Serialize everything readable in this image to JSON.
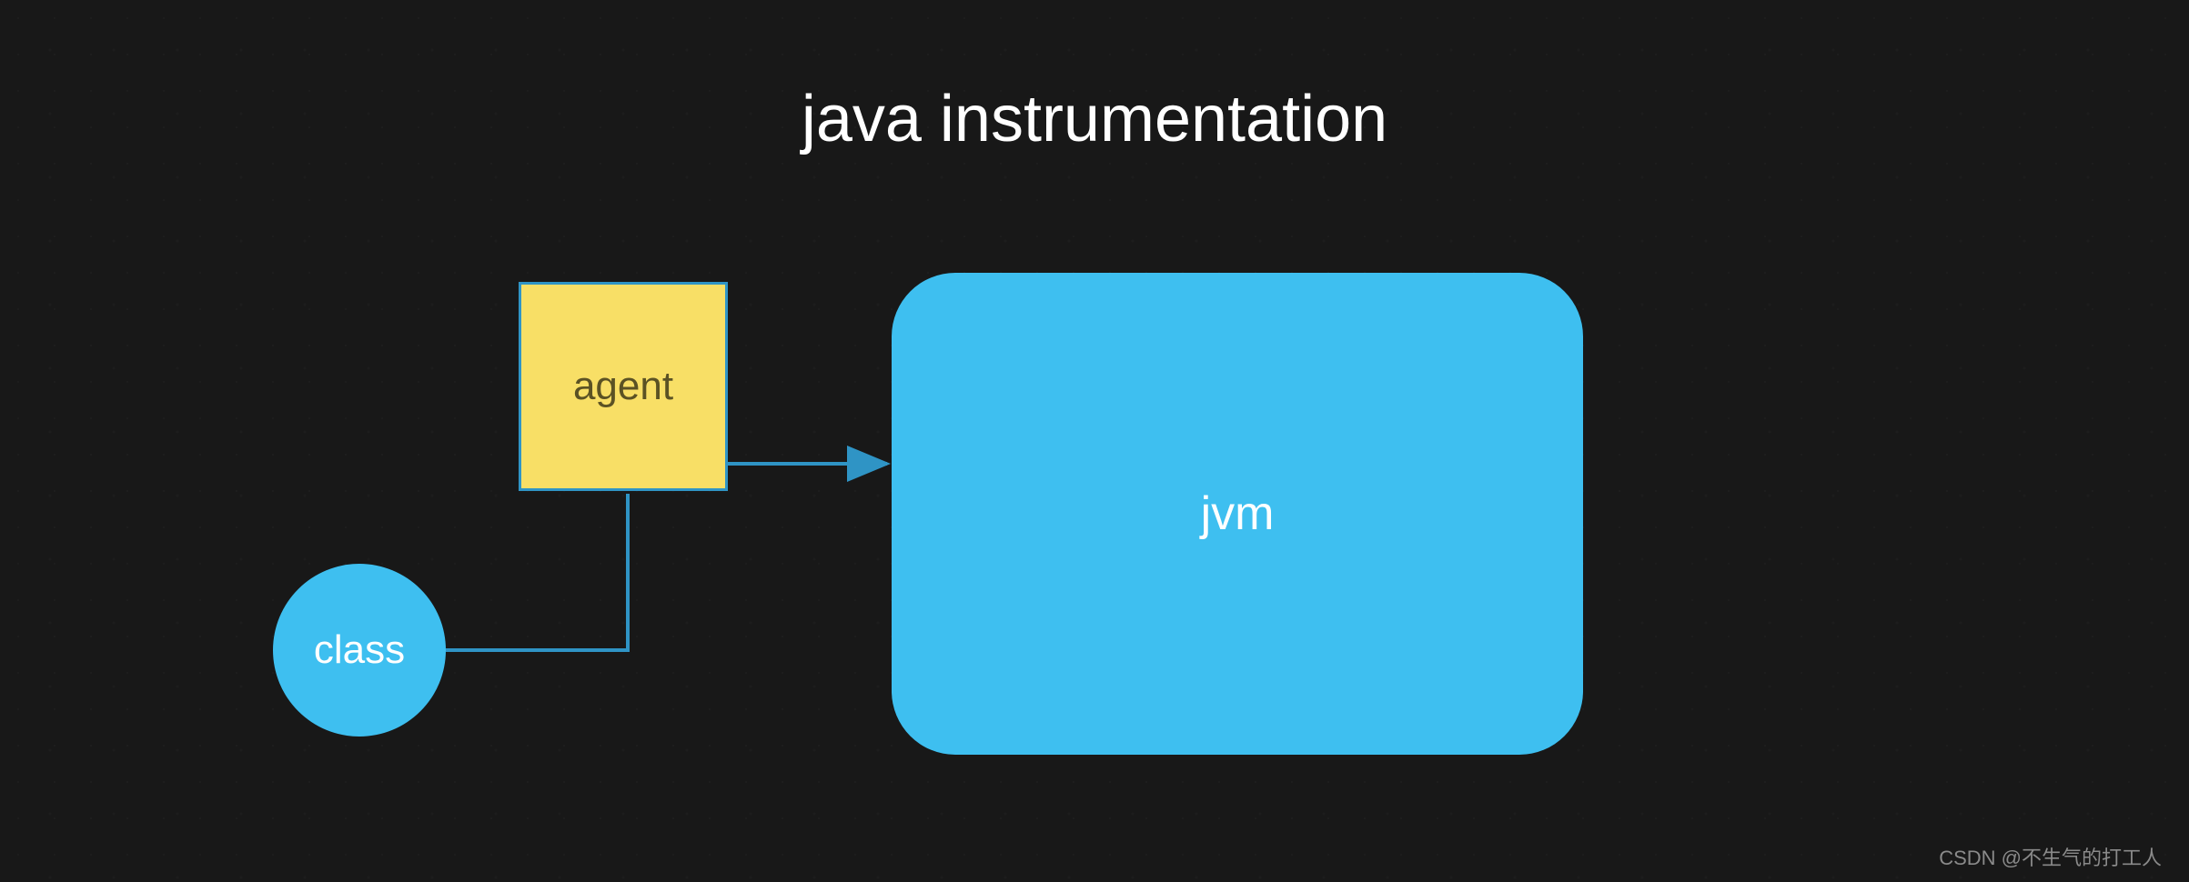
{
  "title": "java instrumentation",
  "nodes": {
    "agent": {
      "label": "agent"
    },
    "class": {
      "label": "class"
    },
    "jvm": {
      "label": "jvm"
    }
  },
  "edges": [
    {
      "from": "agent",
      "to": "jvm",
      "arrow": true
    },
    {
      "from": "class",
      "to": "agent",
      "arrow": false
    }
  ],
  "colors": {
    "background": "#181818",
    "node_blue": "#3ebff0",
    "node_yellow": "#f8df66",
    "stroke_blue": "#2f94c5",
    "title_text": "#ffffff"
  },
  "watermark": "CSDN @不生气的打工人"
}
